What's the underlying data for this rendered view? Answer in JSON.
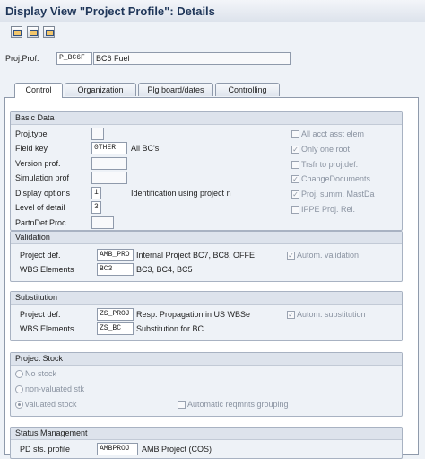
{
  "window": {
    "title": "Display View \"Project Profile\": Details"
  },
  "toolbar": {
    "icons": [
      "save-icon",
      "previous-entry-icon",
      "next-entry-icon"
    ]
  },
  "header": {
    "label": "Proj.Prof.",
    "code": "P_BC6F",
    "description": "BC6 Fuel"
  },
  "tabs": [
    "Control",
    "Organization",
    "Plg board/dates",
    "Controlling"
  ],
  "basic_data": {
    "title": "Basic Data",
    "fields": [
      {
        "label": "Proj.type",
        "value": "",
        "text": ""
      },
      {
        "label": "Field key",
        "value": "0THER",
        "text": "All BC's"
      },
      {
        "label": "Version prof.",
        "value": "",
        "text": ""
      },
      {
        "label": "Simulation prof",
        "value": "",
        "text": ""
      },
      {
        "label": "Display options",
        "value": "1",
        "text": "Identification using project n"
      },
      {
        "label": "Level of detail",
        "value": "3",
        "text": ""
      },
      {
        "label": "PartnDet.Proc.",
        "value": "",
        "text": ""
      }
    ],
    "checkboxes": [
      {
        "label": "All acct asst elem",
        "checked": false
      },
      {
        "label": "Only one root",
        "checked": true
      },
      {
        "label": "Trsfr to proj.def.",
        "checked": false
      },
      {
        "label": "ChangeDocuments",
        "checked": true
      },
      {
        "label": "Proj. summ. MastDa",
        "checked": true
      },
      {
        "label": "IPPE Proj. Rel.",
        "checked": false
      }
    ]
  },
  "validation": {
    "title": "Validation",
    "rows": [
      {
        "label": "Project def.",
        "value": "AMB_PRO",
        "text": "Internal Project BC7, BC8, OFFE"
      },
      {
        "label": "WBS Elements",
        "value": "BC3",
        "text": "BC3, BC4, BC5"
      }
    ],
    "checkbox": {
      "label": "Autom. validation",
      "checked": true
    }
  },
  "substitution": {
    "title": "Substitution",
    "rows": [
      {
        "label": "Project def.",
        "value": "ZS_PROJ",
        "text": "Resp. Propagation in US WBSe"
      },
      {
        "label": "WBS Elements",
        "value": "ZS_BC",
        "text": "Substitution for BC"
      }
    ],
    "checkbox": {
      "label": "Autom. substitution",
      "checked": true
    }
  },
  "project_stock": {
    "title": "Project Stock",
    "options": [
      {
        "label": "No stock",
        "selected": false
      },
      {
        "label": "non-valuated stk",
        "selected": false
      },
      {
        "label": "valuated stock",
        "selected": true
      }
    ],
    "checkbox": {
      "label": "Automatic reqmnts grouping",
      "checked": false
    }
  },
  "status_management": {
    "title": "Status Management",
    "row": {
      "label": "PD sts. profile",
      "value": "AMBPROJ",
      "text": "AMB Project (COS)"
    }
  },
  "colors": {
    "title": "#1f3659",
    "group_bg": "#eef2f7",
    "panel_bg": "#ffffff",
    "disabled_text": "#8a93a1"
  }
}
